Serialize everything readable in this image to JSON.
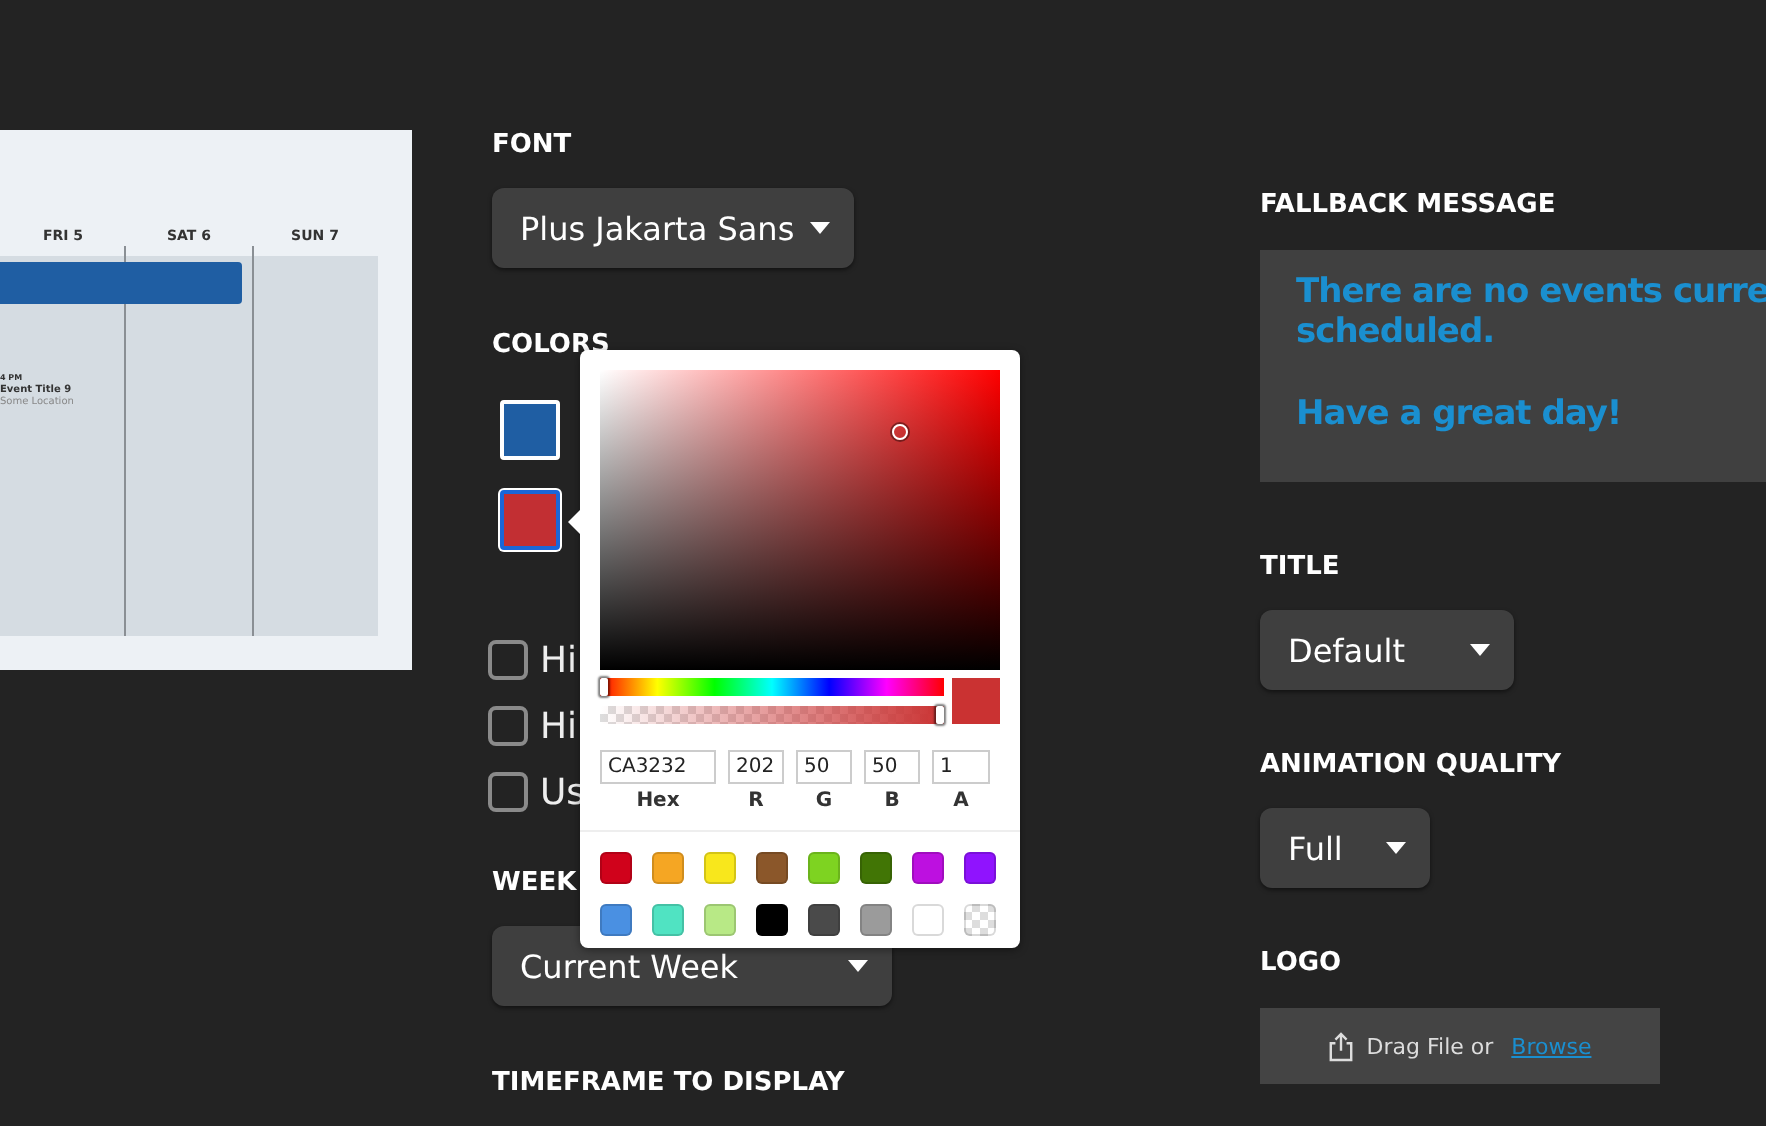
{
  "preview": {
    "days": [
      {
        "label": "FRI 5"
      },
      {
        "label": "SAT 6"
      },
      {
        "label": "SUN 7"
      }
    ],
    "event_bar": {
      "color": "#1f5ea3"
    },
    "event": {
      "time": "4 PM",
      "title": "Event Title 9",
      "location": "Some Location"
    }
  },
  "font": {
    "label": "FONT",
    "value": "Plus Jakarta Sans"
  },
  "colors": {
    "label": "COLORS",
    "swatches": [
      {
        "color": "#1f5ea3",
        "selected": false
      },
      {
        "color": "#c22f33",
        "selected": true
      }
    ]
  },
  "checkboxes": [
    {
      "label": "Hi",
      "checked": false
    },
    {
      "label": "Hi",
      "checked": false
    },
    {
      "label": "Us",
      "checked": false
    }
  ],
  "week": {
    "label": "WEEK",
    "value": "Current Week"
  },
  "timeframe": {
    "label": "TIMEFRAME TO DISPLAY"
  },
  "color_picker": {
    "hue": {
      "level": 0
    },
    "alpha": {
      "level": 1
    },
    "fields": [
      {
        "label": "Hex",
        "value": "CA3232"
      },
      {
        "label": "R",
        "value": "202"
      },
      {
        "label": "G",
        "value": "50"
      },
      {
        "label": "B",
        "value": "50"
      },
      {
        "label": "A",
        "value": "1"
      }
    ],
    "presets": [
      {
        "kind": "solid",
        "color": "#d0021b"
      },
      {
        "kind": "solid",
        "color": "#f5a623"
      },
      {
        "kind": "solid",
        "color": "#f8e71c"
      },
      {
        "kind": "solid",
        "color": "#8b572a"
      },
      {
        "kind": "solid",
        "color": "#7ed321"
      },
      {
        "kind": "solid",
        "color": "#417505"
      },
      {
        "kind": "solid",
        "color": "#bd10e0"
      },
      {
        "kind": "solid",
        "color": "#9013fe"
      },
      {
        "kind": "solid",
        "color": "#4a90e2"
      },
      {
        "kind": "solid",
        "color": "#50e3c2"
      },
      {
        "kind": "solid",
        "color": "#b8e986"
      },
      {
        "kind": "solid",
        "color": "#000000"
      },
      {
        "kind": "solid",
        "color": "#4a4a4a"
      },
      {
        "kind": "solid",
        "color": "#9b9b9b"
      },
      {
        "kind": "solid",
        "color": "#ffffff"
      },
      {
        "kind": "transparent"
      }
    ]
  },
  "fallback": {
    "label": "FALLBACK MESSAGE",
    "paragraphs": [
      [
        "There are no events curre",
        "scheduled."
      ],
      [
        "Have a great day!"
      ]
    ]
  },
  "title": {
    "label": "TITLE",
    "value": "Default"
  },
  "animation_quality": {
    "label": "ANIMATION QUALITY",
    "value": "Full"
  },
  "logo": {
    "label": "LOGO",
    "text": "Drag File or",
    "link": "Browse"
  }
}
